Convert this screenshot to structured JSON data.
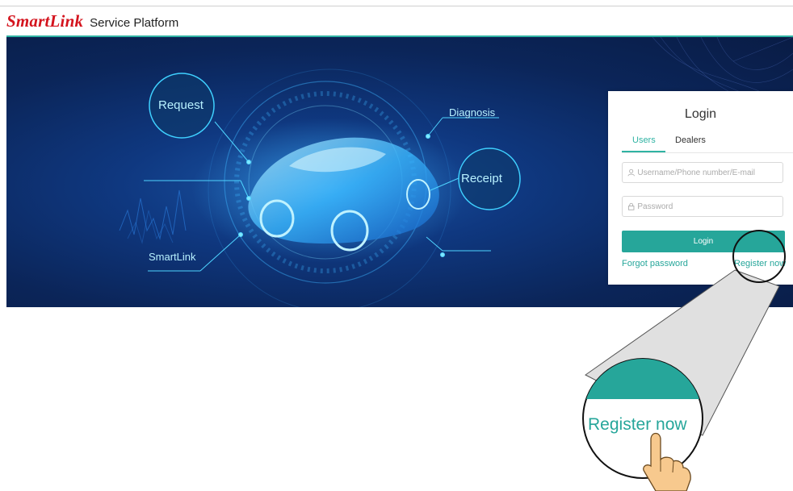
{
  "header": {
    "brand": "SmartLink",
    "title": "Service Platform"
  },
  "banner": {
    "labels": {
      "request": "Request",
      "diagnosis": "Diagnosis",
      "receipt": "Receipt",
      "smartlink": "SmartLink"
    }
  },
  "login": {
    "title": "Login",
    "tabs": [
      {
        "label": "Users",
        "active": true
      },
      {
        "label": "Dealers",
        "active": false
      }
    ],
    "username_placeholder": "Username/Phone number/E-mail",
    "password_placeholder": "Password",
    "button_label": "Login",
    "forgot_label": "Forgot password",
    "register_label": "Register now"
  },
  "callout": {
    "zoom_text": "Register now"
  },
  "colors": {
    "accent": "#26a69a",
    "brand_red": "#d4141e",
    "banner_bg": "#0b2559"
  },
  "icons": [
    "user-icon",
    "lock-icon",
    "hand-pointer-icon"
  ]
}
